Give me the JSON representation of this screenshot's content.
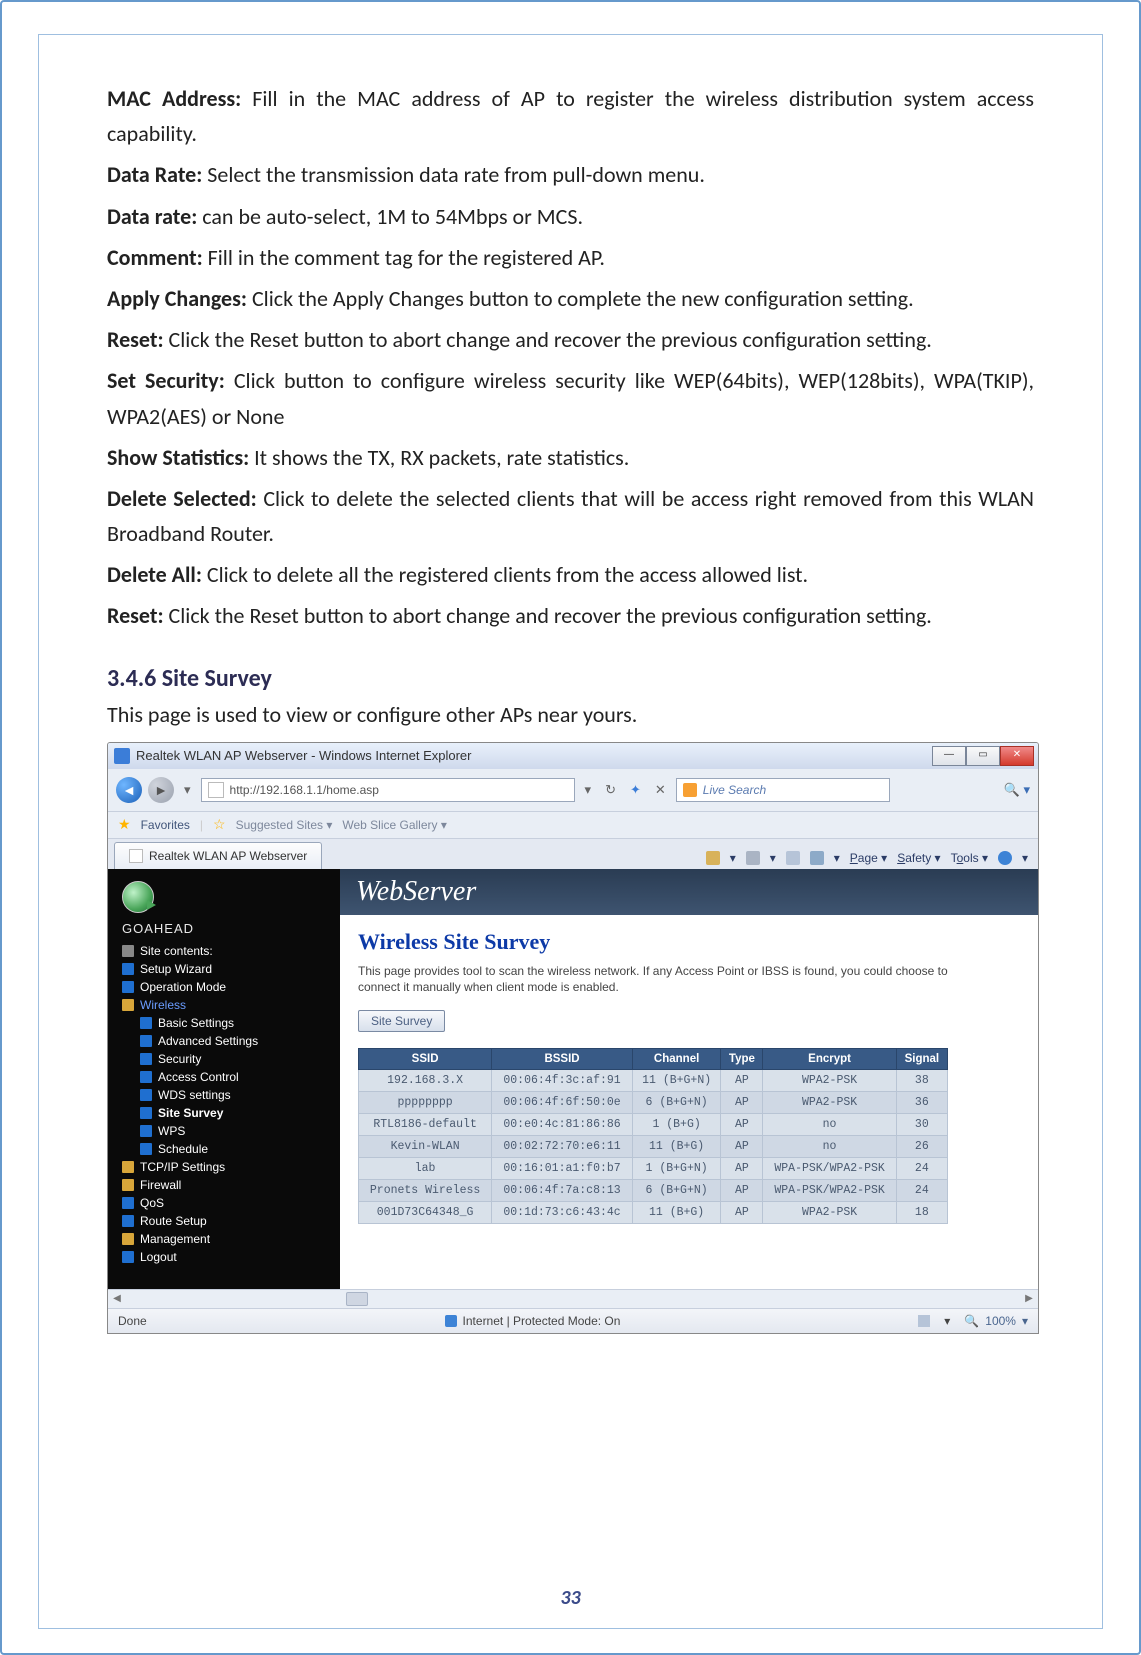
{
  "doc": {
    "items": [
      {
        "label": "MAC Address:",
        "text": "Fill in the MAC address of AP to register the wireless distribution system access capability."
      },
      {
        "label": "Data Rate:",
        "text": "Select the transmission data rate from pull-down menu."
      },
      {
        "label": "Data rate:",
        "text": "can be auto-select, 1M to 54Mbps or MCS."
      },
      {
        "label": "Comment:",
        "text": "Fill in the comment tag for the registered AP."
      },
      {
        "label": "Apply Changes:",
        "text": "Click the Apply Changes button to complete the new configuration setting."
      },
      {
        "label": "Reset:",
        "text": "Click the Reset button to abort change and recover the previous configuration setting."
      },
      {
        "label": "Set Security:",
        "text": "Click button to configure wireless security like WEP(64bits), WEP(128bits), WPA(TKIP), WPA2(AES) or None"
      },
      {
        "label": "Show Statistics:",
        "text": "It shows the TX, RX packets, rate statistics."
      },
      {
        "label": "Delete Selected:",
        "text": "Click to delete the selected clients that will be access right removed from this WLAN Broadband Router."
      },
      {
        "label": "Delete All:",
        "text": "Click to delete all the registered clients from the access allowed list."
      },
      {
        "label": "Reset:",
        "text": "Click the Reset button to abort change and recover the previous configuration setting."
      }
    ],
    "section_heading": "3.4.6    Site Survey",
    "section_desc": "This page is used to view or configure other APs near yours.",
    "page_number": "33"
  },
  "browser": {
    "window_title": "Realtek WLAN AP Webserver - Windows Internet Explorer",
    "url": "http://192.168.1.1/home.asp",
    "search_placeholder": "Live Search",
    "fav_label": "Favorites",
    "fav_links": [
      "Suggested Sites ▾",
      "Web Slice Gallery ▾"
    ],
    "tab_title": "Realtek WLAN AP Webserver",
    "toolbar": {
      "page": "Page ▾",
      "safety": "Safety ▾",
      "tools": "Tools ▾"
    },
    "status_left": "Done",
    "status_center": "Internet | Protected Mode: On",
    "zoom": "100%"
  },
  "app": {
    "brand": "GOAHEAD",
    "header": "WebServer",
    "tree_root": "Site contents:",
    "tree": [
      {
        "label": "Setup Wizard",
        "ic": "doc"
      },
      {
        "label": "Operation Mode",
        "ic": "doc"
      },
      {
        "label": "Wireless",
        "ic": "folder",
        "open": true,
        "children": [
          {
            "label": "Basic Settings",
            "ic": "doc"
          },
          {
            "label": "Advanced Settings",
            "ic": "doc"
          },
          {
            "label": "Security",
            "ic": "doc"
          },
          {
            "label": "Access Control",
            "ic": "doc"
          },
          {
            "label": "WDS settings",
            "ic": "doc"
          },
          {
            "label": "Site Survey",
            "ic": "doc",
            "sel": true
          },
          {
            "label": "WPS",
            "ic": "doc"
          },
          {
            "label": "Schedule",
            "ic": "doc"
          }
        ]
      },
      {
        "label": "TCP/IP Settings",
        "ic": "folder"
      },
      {
        "label": "Firewall",
        "ic": "folder"
      },
      {
        "label": "QoS",
        "ic": "doc"
      },
      {
        "label": "Route Setup",
        "ic": "doc"
      },
      {
        "label": "Management",
        "ic": "folder"
      },
      {
        "label": "Logout",
        "ic": "doc"
      }
    ],
    "page_title": "Wireless Site Survey",
    "page_desc": "This page provides tool to scan the wireless network. If any Access Point or IBSS is found, you could choose to connect it manually when client mode is enabled.",
    "scan_button": "Site Survey",
    "columns": [
      "SSID",
      "BSSID",
      "Channel",
      "Type",
      "Encrypt",
      "Signal"
    ],
    "rows": [
      {
        "ssid": "192.168.3.X",
        "bssid": "00:06:4f:3c:af:91",
        "chan": "11 (B+G+N)",
        "type": "AP",
        "enc": "WPA2-PSK",
        "sig": "38"
      },
      {
        "ssid": "pppppppp",
        "bssid": "00:06:4f:6f:50:0e",
        "chan": "6 (B+G+N)",
        "type": "AP",
        "enc": "WPA2-PSK",
        "sig": "36"
      },
      {
        "ssid": "RTL8186-default",
        "bssid": "00:e0:4c:81:86:86",
        "chan": "1 (B+G)",
        "type": "AP",
        "enc": "no",
        "sig": "30"
      },
      {
        "ssid": "Kevin-WLAN",
        "bssid": "00:02:72:70:e6:11",
        "chan": "11 (B+G)",
        "type": "AP",
        "enc": "no",
        "sig": "26"
      },
      {
        "ssid": "lab",
        "bssid": "00:16:01:a1:f0:b7",
        "chan": "1 (B+G+N)",
        "type": "AP",
        "enc": "WPA-PSK/WPA2-PSK",
        "sig": "24"
      },
      {
        "ssid": "Pronets Wireless",
        "bssid": "00:06:4f:7a:c8:13",
        "chan": "6 (B+G+N)",
        "type": "AP",
        "enc": "WPA-PSK/WPA2-PSK",
        "sig": "24"
      },
      {
        "ssid": "001D73C64348_G",
        "bssid": "00:1d:73:c6:43:4c",
        "chan": "11 (B+G)",
        "type": "AP",
        "enc": "WPA2-PSK",
        "sig": "18"
      }
    ]
  }
}
